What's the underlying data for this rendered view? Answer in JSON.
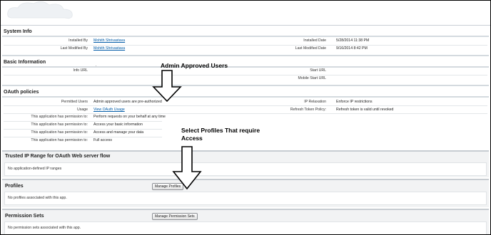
{
  "system_info": {
    "title": "System Info",
    "installed_by_label": "Installed By",
    "installed_by_value": "Mohith Shrivastava",
    "last_modified_by_label": "Last Modified By",
    "last_modified_by_value": "Mohith Shrivastava",
    "installed_date_label": "Installed Date",
    "installed_date_value": "5/28/2014 11:38 PM",
    "last_modified_date_label": "Last Modified Date",
    "last_modified_date_value": "9/16/2014 8:42 PM"
  },
  "basic_information": {
    "title": "Basic Information",
    "info_url_label": "Info URL",
    "info_url_value": ".",
    "start_url_label": "Start URL",
    "mobile_start_url_label": "Mobile Start URL"
  },
  "oauth_policies": {
    "title": "OAuth policies",
    "permitted_users_label": "Permitted Users",
    "permitted_users_value": "Admin approved users are pre-authorized",
    "usage_label": "Usage",
    "usage_link": "View OAuth Usage",
    "ip_relaxation_label": "IP Relaxation",
    "ip_relaxation_value": "Enforce IP restrictions",
    "refresh_token_label": "Refresh Token Policy:",
    "refresh_token_value": "Refresh token is valid until revoked",
    "permission_label": "This application has permission to:",
    "permissions": [
      "Perform requests on your behalf at any time",
      "Access your basic information",
      "Access and manage your data",
      "Full access"
    ]
  },
  "trusted_ip": {
    "title": "Trusted IP Range for OAuth Web server flow",
    "empty_text": "No application-defined IP ranges"
  },
  "profiles": {
    "title": "Profiles",
    "button_label": "Manage Profiles",
    "empty_text": "No profiles associated with this app."
  },
  "permission_sets": {
    "title": "Permission Sets",
    "button_label": "Manage Permission Sets",
    "empty_text": "No permission sets associated with this app."
  },
  "annotations": {
    "admin_approved": "Admin Approved Users",
    "select_profiles_line1": "Select Profiles That require",
    "select_profiles_line2": "Access"
  },
  "colors": {
    "link": "#015ba7",
    "section_border": "#c7ccd1",
    "panel_background": "#f2f3f4"
  }
}
